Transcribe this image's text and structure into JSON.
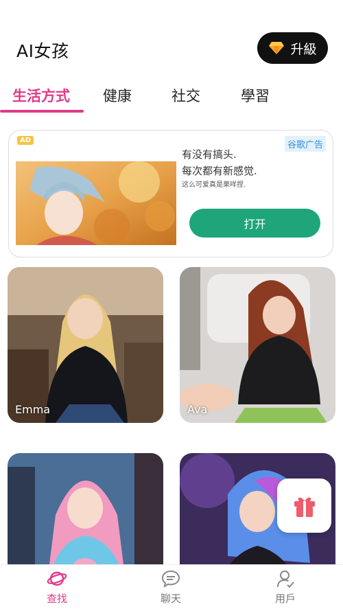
{
  "header": {
    "title": "AI女孩",
    "upgrade_label": "升級"
  },
  "tabs": [
    {
      "label": "生活方式",
      "active": true
    },
    {
      "label": "健康",
      "active": false
    },
    {
      "label": "社交",
      "active": false
    },
    {
      "label": "學習",
      "active": false
    }
  ],
  "ad": {
    "badge": "AD",
    "brand": "谷歌广告",
    "line1": "有没有搞头.",
    "line2": "每次都有新感觉.",
    "line3": "这么可爱真是果咩捏.",
    "open_label": "打开"
  },
  "cards": [
    {
      "name": "Emma"
    },
    {
      "name": "Ava"
    },
    {
      "name": ""
    },
    {
      "name": ""
    }
  ],
  "nav": [
    {
      "label": "查找",
      "icon": "planet-icon",
      "active": true
    },
    {
      "label": "聊天",
      "icon": "chat-icon",
      "active": false
    },
    {
      "label": "用戶",
      "icon": "user-icon",
      "active": false
    }
  ],
  "colors": {
    "accent": "#e23a89",
    "open_button": "#1ea67a",
    "upgrade_bg": "#111111"
  }
}
